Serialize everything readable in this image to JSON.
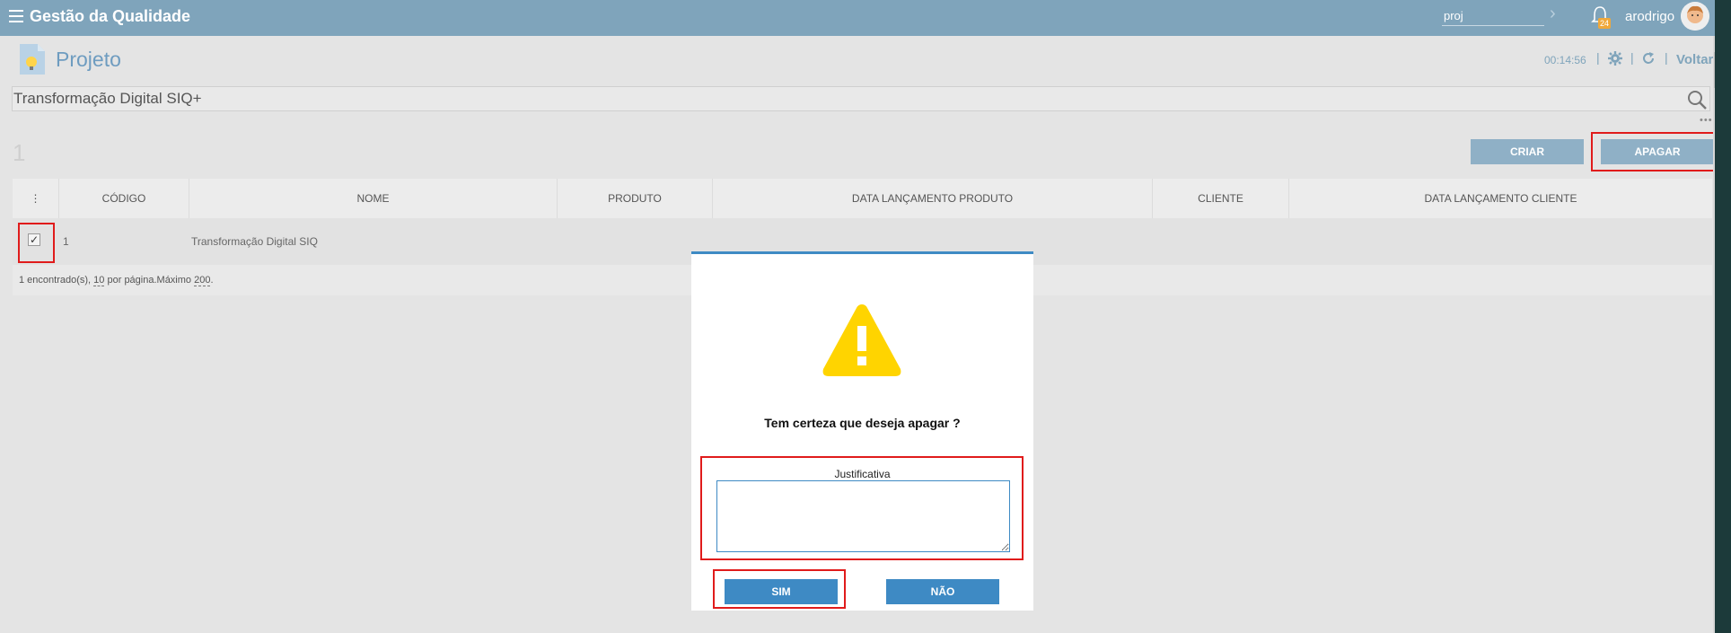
{
  "header": {
    "app_title": "Gestão da Qualidade",
    "search_value": "proj",
    "notification_count": "24",
    "username": "arodrigo",
    "menu_icon": "hamburger-menu-icon",
    "bell_icon": "bell-icon"
  },
  "page": {
    "title": "Projeto",
    "timer": "00:14:56",
    "back_label": "Voltar",
    "search_value": "Transformação Digital SIQ+",
    "result_count": "1"
  },
  "toolbar": {
    "create_label": "CRIAR",
    "delete_label": "APAGAR"
  },
  "table": {
    "columns": [
      "CÓDIGO",
      "NOME",
      "PRODUTO",
      "DATA LANÇAMENTO PRODUTO",
      "CLIENTE",
      "DATA LANÇAMENTO CLIENTE"
    ],
    "rows": [
      {
        "selected": true,
        "codigo": "1",
        "nome": "Transformação Digital SIQ",
        "produto": "",
        "data_produto": "",
        "cliente": "",
        "data_cliente": ""
      }
    ],
    "footer": {
      "found": "1 encontrado(s),",
      "per_page": "10",
      "per_page_suffix": "por página.Máximo",
      "max": "200",
      "end": "."
    }
  },
  "modal": {
    "message": "Tem certeza que deseja apagar ?",
    "justification_label": "Justificativa",
    "justification_value": "",
    "yes_label": "SIM",
    "no_label": "NÃO",
    "icon": "warning-icon"
  },
  "colors": {
    "header_bg": "#7fa4bb",
    "accent": "#3e8ac4",
    "highlight": "#e01b1b",
    "warning": "#ffd400"
  }
}
